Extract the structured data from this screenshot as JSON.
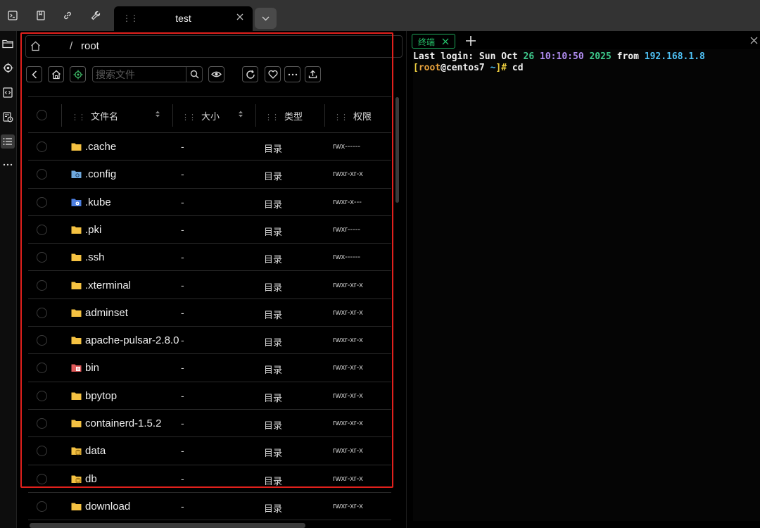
{
  "tab": {
    "title": "test"
  },
  "breadcrumb": {
    "separator": "/",
    "path": "root"
  },
  "toolbar": {
    "search_placeholder": "搜索文件"
  },
  "table": {
    "columns": [
      "文件名",
      "大小",
      "类型",
      "权限"
    ],
    "rows": [
      {
        "name": ".cache",
        "size": "-",
        "type": "目录",
        "perm": "rwx------",
        "icon": "folder-icon"
      },
      {
        "name": ".config",
        "size": "-",
        "type": "目录",
        "perm": "rwxr-xr-x",
        "icon": "config-folder-icon"
      },
      {
        "name": ".kube",
        "size": "-",
        "type": "目录",
        "perm": "rwxr-x---",
        "icon": "kube-folder-icon"
      },
      {
        "name": ".pki",
        "size": "-",
        "type": "目录",
        "perm": "rwxr-----",
        "icon": "folder-icon"
      },
      {
        "name": ".ssh",
        "size": "-",
        "type": "目录",
        "perm": "rwx------",
        "icon": "folder-icon"
      },
      {
        "name": ".xterminal",
        "size": "-",
        "type": "目录",
        "perm": "rwxr-xr-x",
        "icon": "folder-icon"
      },
      {
        "name": "adminset",
        "size": "-",
        "type": "目录",
        "perm": "rwxr-xr-x",
        "icon": "folder-icon"
      },
      {
        "name": "apache-pulsar-2.8.0",
        "size": "-",
        "type": "目录",
        "perm": "rwxr-xr-x",
        "icon": "folder-icon"
      },
      {
        "name": "bin",
        "size": "-",
        "type": "目录",
        "perm": "rwxr-xr-x",
        "icon": "bin-folder-icon"
      },
      {
        "name": "bpytop",
        "size": "-",
        "type": "目录",
        "perm": "rwxr-xr-x",
        "icon": "folder-icon"
      },
      {
        "name": "containerd-1.5.2",
        "size": "-",
        "type": "目录",
        "perm": "rwxr-xr-x",
        "icon": "folder-icon"
      },
      {
        "name": "data",
        "size": "-",
        "type": "目录",
        "perm": "rwxr-xr-x",
        "icon": "data-folder-icon"
      },
      {
        "name": "db",
        "size": "-",
        "type": "目录",
        "perm": "rwxr-xr-x",
        "icon": "data-folder-icon"
      },
      {
        "name": "download",
        "size": "-",
        "type": "目录",
        "perm": "rwxr-xr-x",
        "icon": "folder-icon"
      }
    ]
  },
  "terminal": {
    "tab_label": "终端",
    "line1": {
      "prefix": "Last login: Sun Oct ",
      "day": "26",
      "time": "10:10:50",
      "year": "2025",
      "from": " from ",
      "ip": "192.168.1.8"
    },
    "line2": {
      "open": "[",
      "user": "root",
      "at": "@centos7 ",
      "dir": "~",
      "close": "]# ",
      "cmd": "cd"
    }
  },
  "colors": {
    "accent": "#1ea85a",
    "highlight": "#e0201c",
    "folder": "#f5c242"
  }
}
